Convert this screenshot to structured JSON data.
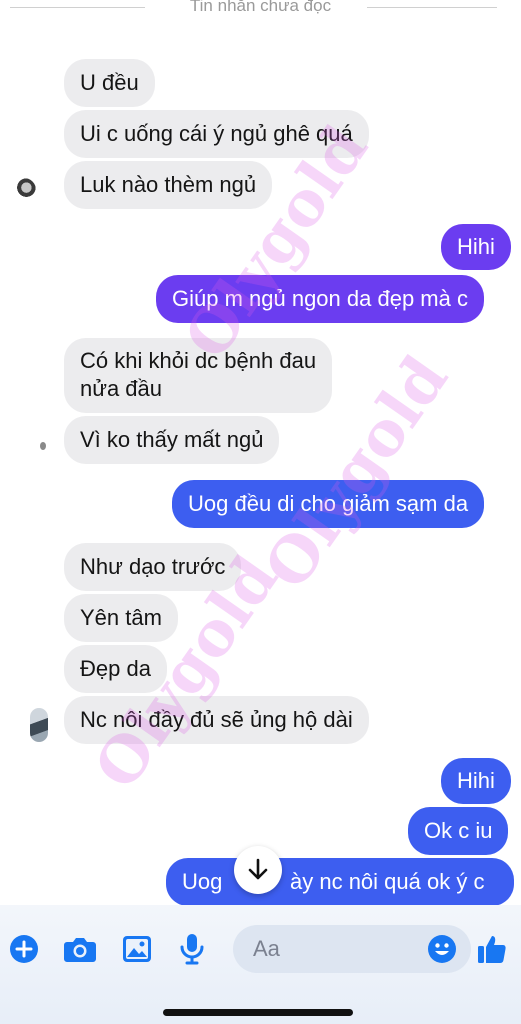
{
  "divider": {
    "label": "Tin nhắn chưa đọc"
  },
  "messages": [
    {
      "side": "in",
      "text": "U đều"
    },
    {
      "side": "in",
      "text": "Ui c uống cái ý ngủ ghê quá"
    },
    {
      "side": "in",
      "text": "Luk nào thèm ngủ"
    },
    {
      "side": "out",
      "text": "Hihi"
    },
    {
      "side": "out",
      "text": "Giúp m ngủ ngon da đẹp mà c"
    },
    {
      "side": "in",
      "text_line1": "Có khi khỏi dc bệnh đau",
      "text_line2": "nửa đầu"
    },
    {
      "side": "in",
      "text": "Vì ko thấy mất ngủ"
    },
    {
      "side": "out",
      "text": "Uog đều di cho giảm sạm da"
    },
    {
      "side": "in",
      "text": "Như dạo trước"
    },
    {
      "side": "in",
      "text": "Yên tâm"
    },
    {
      "side": "in",
      "text": "Đẹp da"
    },
    {
      "side": "in",
      "text": "Nc nôi đầy đủ sẽ ủng hộ dài"
    },
    {
      "side": "out",
      "text": "Hihi"
    },
    {
      "side": "out",
      "text": "Ok c iu"
    },
    {
      "side": "out",
      "text_left": "Uog",
      "text_right": "ày nc nôi quá ok ý c"
    }
  ],
  "watermark": {
    "text": "Olygold"
  },
  "composer": {
    "placeholder": "Aa",
    "icons": [
      "plus-circle-icon",
      "camera-icon",
      "image-icon",
      "microphone-icon",
      "emoji-icon",
      "thumbs-up-icon"
    ]
  },
  "colors": {
    "incoming_bubble": "#ececee",
    "outgoing_bubble": "#6b3df0",
    "outgoing_bubble_blue": "#3d5ef0",
    "accent": "#1877f2"
  }
}
